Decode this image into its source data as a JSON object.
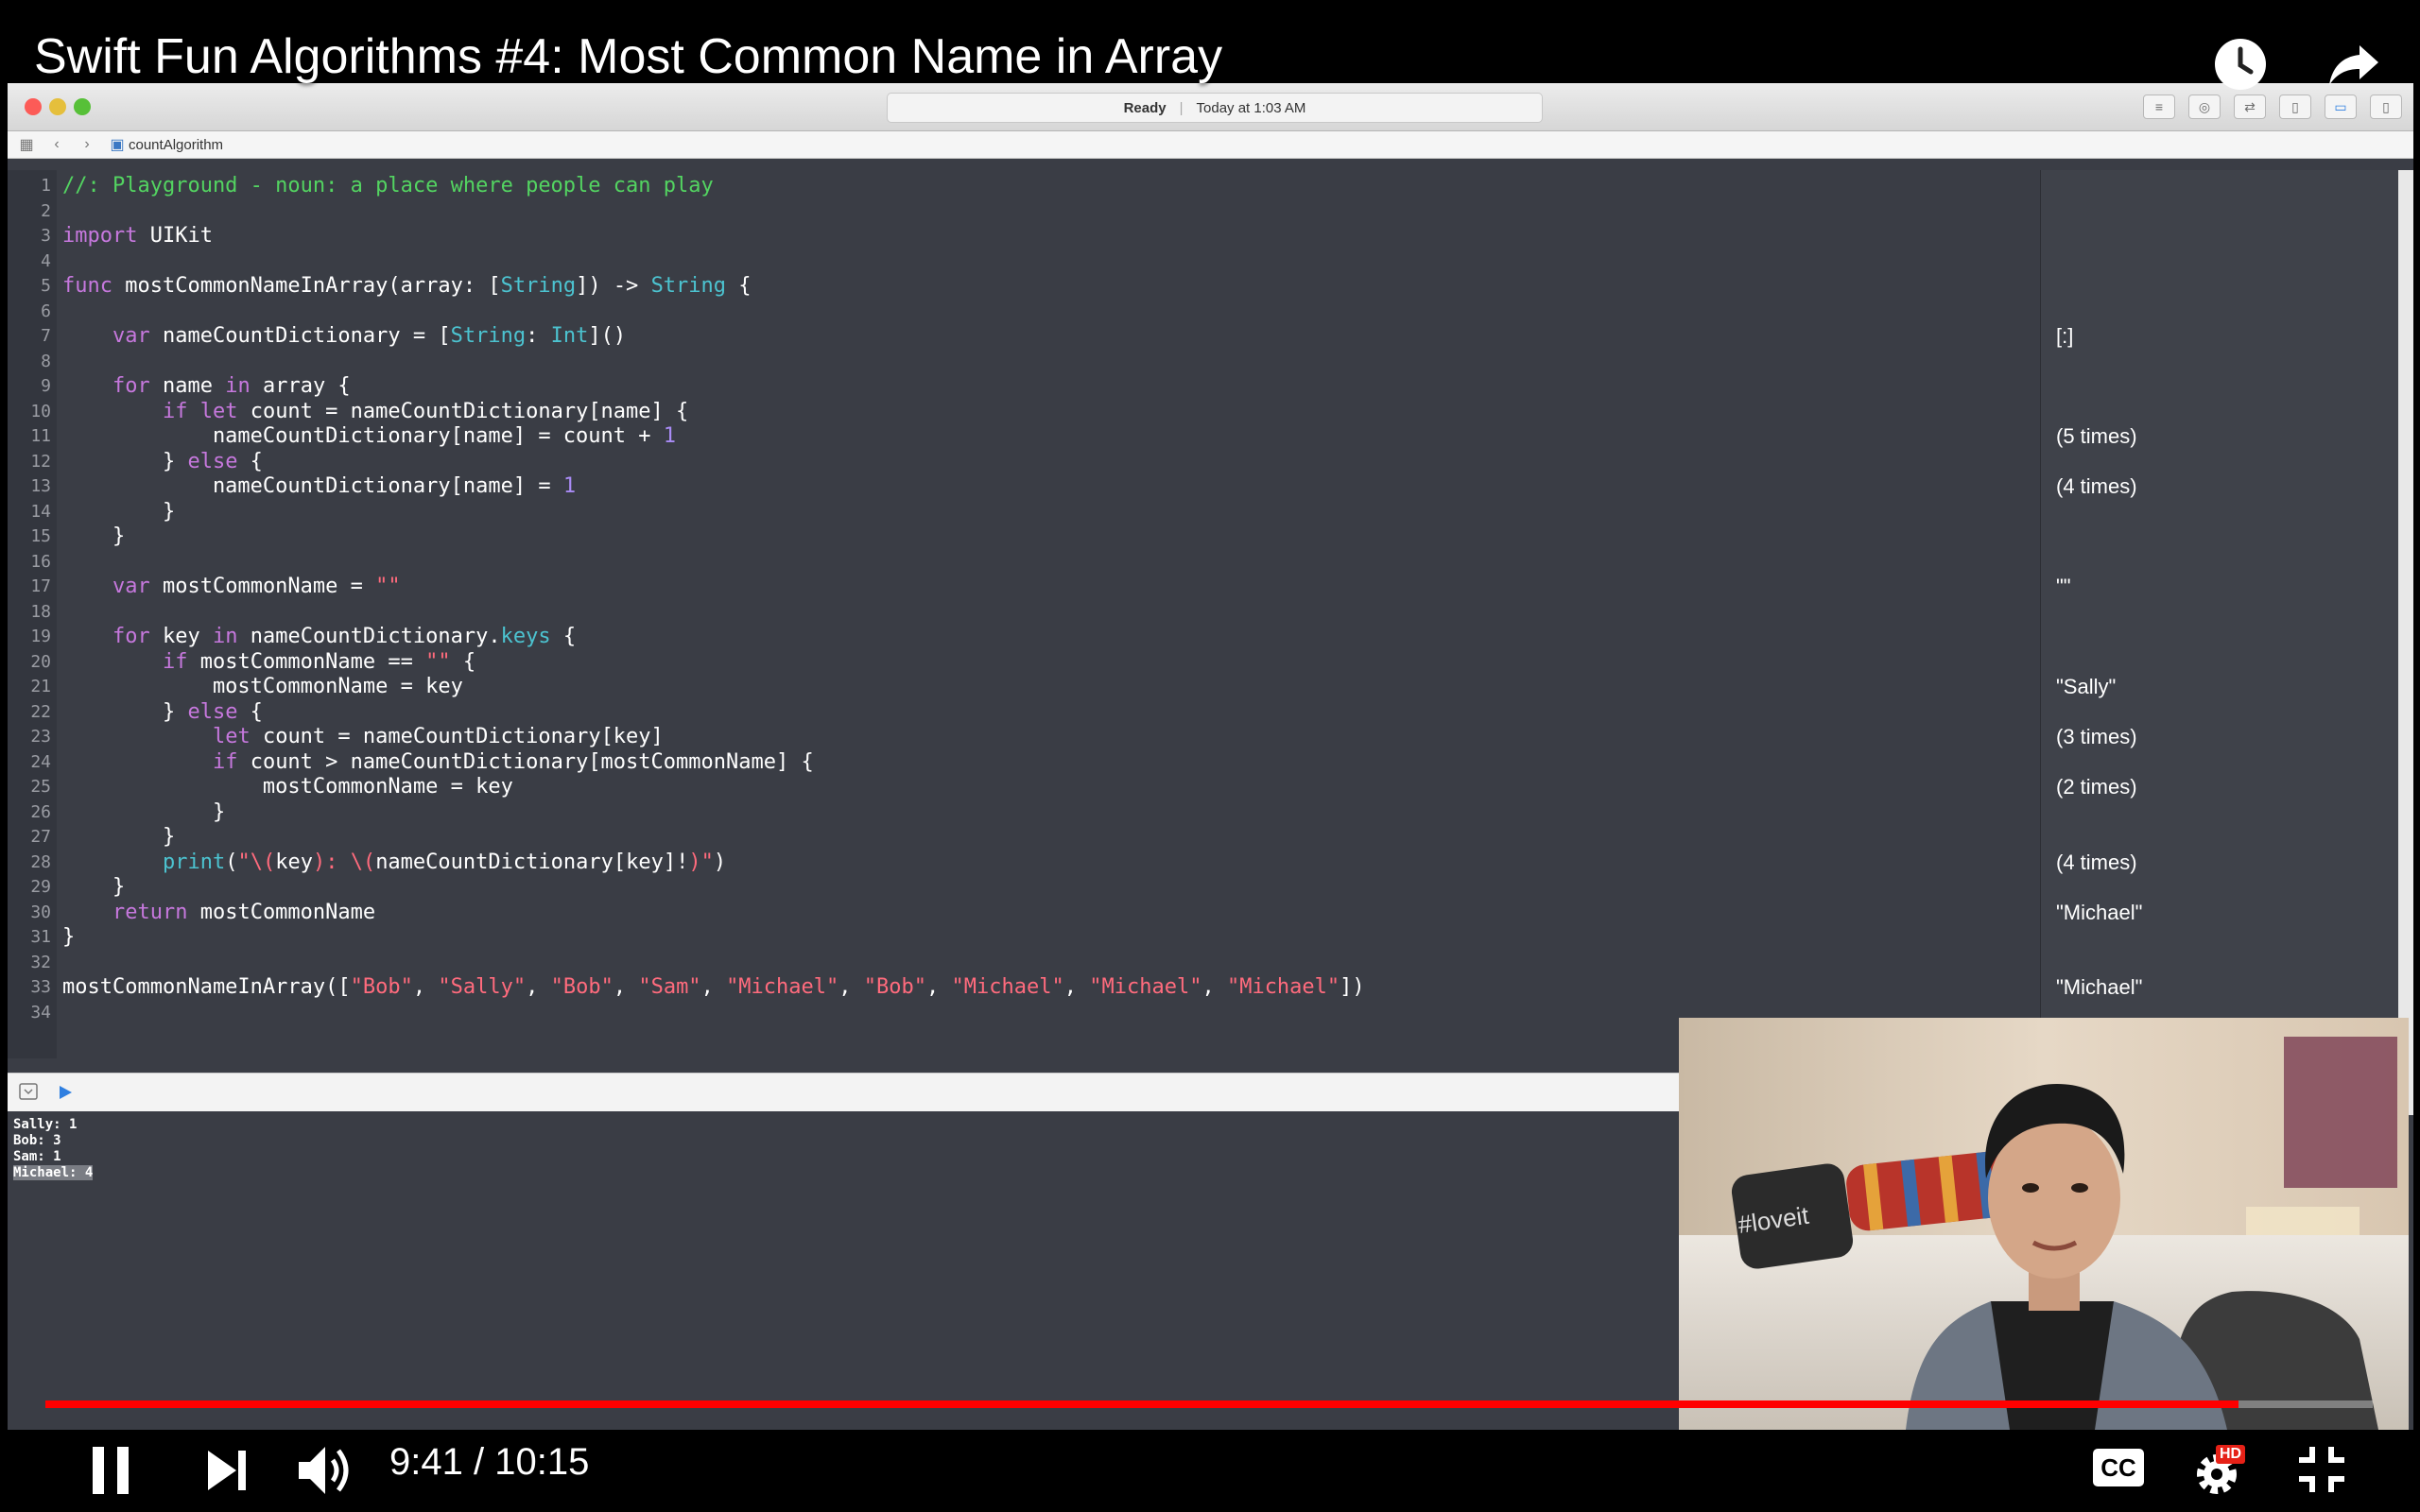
{
  "video": {
    "title": "Swift Fun Algorithms #4: Most Common Name in Array",
    "time_current": "9:41",
    "time_separator": "/",
    "time_total": "10:15",
    "progress_fraction": 0.9425,
    "accent": "#ff0000",
    "icons": [
      "watch-later-icon",
      "share-icon",
      "pause-icon",
      "next-icon",
      "volume-icon",
      "captions-icon",
      "settings-icon",
      "exit-fullscreen-icon"
    ],
    "hd_badge": "HD",
    "cc_label": "CC"
  },
  "xcode": {
    "status": "Ready",
    "status_time": "Today at 1:03 AM",
    "file_name": "countAlgorithm",
    "code_lines": [
      {
        "n": "1",
        "html": "<span class='cmt'>//: Playground - noun: a place where people can play</span>"
      },
      {
        "n": "2",
        "html": ""
      },
      {
        "n": "3",
        "html": "<span class='kw'>import</span> UIKit"
      },
      {
        "n": "4",
        "html": ""
      },
      {
        "n": "5",
        "html": "<span class='kw'>func</span> mostCommonNameInArray(array: [<span class='ty'>String</span>]) -&gt; <span class='ty'>String</span> {"
      },
      {
        "n": "6",
        "html": ""
      },
      {
        "n": "7",
        "html": "    <span class='kw'>var</span> nameCountDictionary = [<span class='ty'>String</span>: <span class='ty'>Int</span>]()"
      },
      {
        "n": "8",
        "html": ""
      },
      {
        "n": "9",
        "html": "    <span class='kw'>for</span> name <span class='kw'>in</span> array {"
      },
      {
        "n": "10",
        "html": "        <span class='kw'>if let</span> count = nameCountDictionary[name] {"
      },
      {
        "n": "11",
        "html": "            nameCountDictionary[name] = count + <span class='num'>1</span>"
      },
      {
        "n": "12",
        "html": "        } <span class='kw'>else</span> {"
      },
      {
        "n": "13",
        "html": "            nameCountDictionary[name] = <span class='num'>1</span>"
      },
      {
        "n": "14",
        "html": "        }"
      },
      {
        "n": "15",
        "html": "    }"
      },
      {
        "n": "16",
        "html": ""
      },
      {
        "n": "17",
        "html": "    <span class='kw'>var</span> mostCommonName = <span class='str'>\"\"</span>"
      },
      {
        "n": "18",
        "html": ""
      },
      {
        "n": "19",
        "html": "    <span class='kw'>for</span> key <span class='kw'>in</span> nameCountDictionary.<span class='fn'>keys</span> {"
      },
      {
        "n": "20",
        "html": "        <span class='kw'>if</span> mostCommonName == <span class='str'>\"\"</span> {"
      },
      {
        "n": "21",
        "html": "            mostCommonName = key"
      },
      {
        "n": "22",
        "html": "        } <span class='kw'>else</span> {"
      },
      {
        "n": "23",
        "html": "            <span class='kw'>let</span> count = nameCountDictionary[key]"
      },
      {
        "n": "24",
        "html": "            <span class='kw'>if</span> count &gt; nameCountDictionary[mostCommonName] {"
      },
      {
        "n": "25",
        "html": "                mostCommonName = key"
      },
      {
        "n": "26",
        "html": "            }"
      },
      {
        "n": "27",
        "html": "        }"
      },
      {
        "n": "28",
        "html": "        <span class='fn'>print</span>(<span class='str'>\"\\(</span>key<span class='str'>): \\(</span>nameCountDictionary[key]!<span class='str'>)\"</span>)"
      },
      {
        "n": "29",
        "html": "    }"
      },
      {
        "n": "30",
        "html": "    <span class='kw'>return</span> mostCommonName"
      },
      {
        "n": "31",
        "html": "}"
      },
      {
        "n": "32",
        "html": ""
      },
      {
        "n": "33",
        "html": "mostCommonNameInArray([<span class='str'>\"Bob\"</span>, <span class='str'>\"Sally\"</span>, <span class='str'>\"Bob\"</span>, <span class='str'>\"Sam\"</span>, <span class='str'>\"Michael\"</span>, <span class='str'>\"Bob\"</span>, <span class='str'>\"Michael\"</span>, <span class='str'>\"Michael\"</span>, <span class='str'>\"Michael\"</span>])"
      },
      {
        "n": "34",
        "html": ""
      }
    ],
    "results": [
      {
        "line": 7,
        "text": "[:]"
      },
      {
        "line": 11,
        "text": "(5 times)"
      },
      {
        "line": 13,
        "text": "(4 times)"
      },
      {
        "line": 17,
        "text": "\"\""
      },
      {
        "line": 21,
        "text": "\"Sally\""
      },
      {
        "line": 23,
        "text": "(3 times)"
      },
      {
        "line": 25,
        "text": "(2 times)"
      },
      {
        "line": 28,
        "text": "(4 times)"
      },
      {
        "line": 30,
        "text": "\"Michael\""
      },
      {
        "line": 33,
        "text": "\"Michael\""
      }
    ],
    "console": [
      "Sally: 1",
      "Bob: 3",
      "Sam: 1",
      "Michael: 4"
    ],
    "webcam_caption": "#loveit"
  }
}
